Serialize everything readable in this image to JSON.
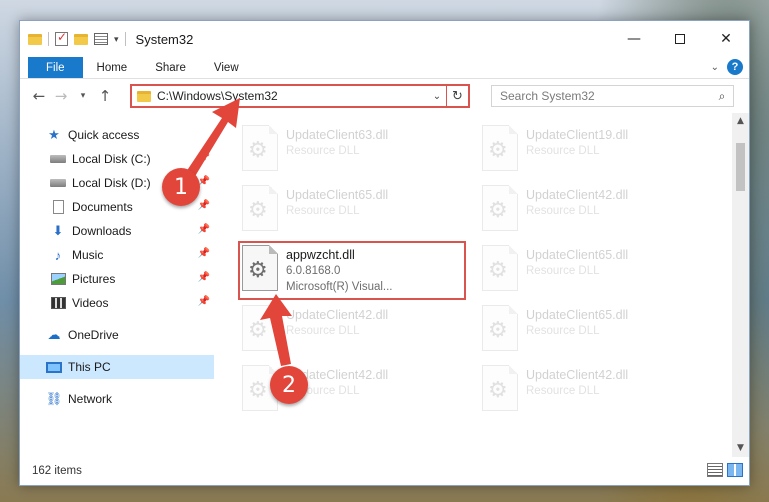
{
  "window": {
    "title": "System32",
    "controls": {
      "minimize": "—",
      "maximize": "",
      "close": "✕"
    }
  },
  "ribbon": {
    "tabs": [
      {
        "label": "File"
      },
      {
        "label": "Home"
      },
      {
        "label": "Share"
      },
      {
        "label": "View"
      }
    ],
    "help": "?"
  },
  "navbar": {
    "address": "C:\\Windows\\System32",
    "search_placeholder": "Search System32"
  },
  "sidebar": {
    "quick_access": "Quick access",
    "pinned": [
      {
        "label": "Local Disk (C:)"
      },
      {
        "label": "Local Disk (D:)"
      },
      {
        "label": "Documents"
      },
      {
        "label": "Downloads"
      },
      {
        "label": "Music"
      },
      {
        "label": "Pictures"
      },
      {
        "label": "Videos"
      }
    ],
    "onedrive": "OneDrive",
    "this_pc": "This PC",
    "network": "Network"
  },
  "files": {
    "selected": {
      "name": "appwzcht.dll",
      "version": "6.0.8168.0",
      "company": "Microsoft(R) Visual..."
    },
    "ghost": [
      {
        "name": "UpdateClient63.dll",
        "desc": "Resource DLL"
      },
      {
        "name": "UpdateClient19.dll",
        "desc": "Resource DLL"
      },
      {
        "name": "UpdateClient65.dll",
        "desc": "Resource DLL"
      },
      {
        "name": "UpdateClient42.dll",
        "desc": "Resource DLL"
      },
      {
        "name": "UpdateClient65.dll",
        "desc": "Resource DLL"
      },
      {
        "name": "UpdateClient42.dll",
        "desc": "Resource DLL"
      },
      {
        "name": "UpdateClient65.dll",
        "desc": "Resource DLL"
      },
      {
        "name": "UpdateClient42.dll",
        "desc": "Resource DLL"
      },
      {
        "name": "UpdateClient42.dll",
        "desc": "Resource DLL"
      }
    ]
  },
  "status": {
    "item_count": "162 items"
  },
  "annotations": {
    "step1": "1",
    "step2": "2",
    "accent": "#e2453a"
  }
}
